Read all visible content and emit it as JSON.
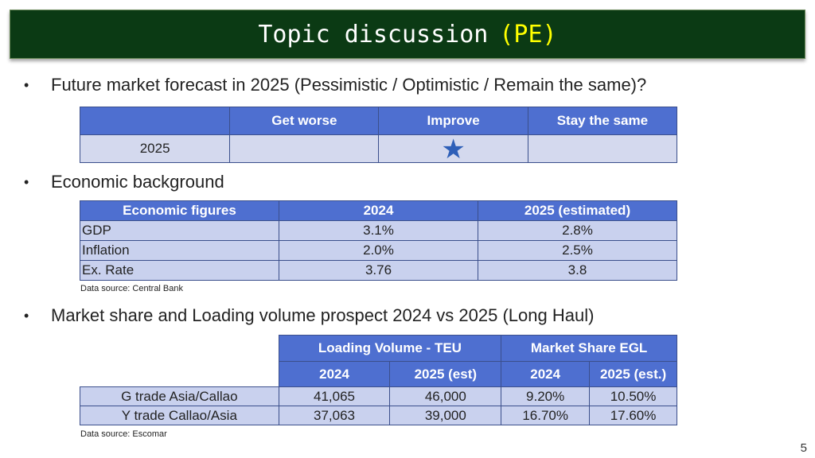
{
  "title": {
    "main": "Topic discussion",
    "accent": "(PE)"
  },
  "bullets": {
    "forecast": "Future market forecast in 2025 (Pessimistic / Optimistic / Remain the same)?",
    "economic": "Economic background",
    "market": "Market share and Loading volume prospect 2024 vs 2025 (Long Haul)"
  },
  "forecast_table": {
    "headers": [
      "",
      "Get worse",
      "Improve",
      "Stay the same"
    ],
    "row": {
      "label": "2025",
      "selected": "Improve",
      "marker_icon": "star-icon"
    }
  },
  "economic_table": {
    "headers": [
      "Economic figures",
      "2024",
      "2025 (estimated)"
    ],
    "rows": [
      [
        "GDP",
        "3.1%",
        "2.8%"
      ],
      [
        "Inflation",
        "2.0%",
        "2.5%"
      ],
      [
        "Ex. Rate",
        "3.76",
        "3.8"
      ]
    ],
    "source": "Data source: Central Bank"
  },
  "market_table": {
    "group_headers": [
      "Loading Volume - TEU",
      "Market Share EGL"
    ],
    "sub_headers": [
      "2024",
      "2025 (est)",
      "2024",
      "2025 (est.)"
    ],
    "rows": [
      [
        "G trade Asia/Callao",
        "41,065",
        "46,000",
        "9.20%",
        "10.50%"
      ],
      [
        "Y trade Callao/Asia",
        "37,063",
        "39,000",
        "16.70%",
        "17.60%"
      ]
    ],
    "source": "Data source: Escomar"
  },
  "colors": {
    "title_bg": "#0b3a14",
    "accent": "#ffff00",
    "header_bg": "#4e6fd0",
    "cell_bg": "#c9d1ee",
    "star": "#2e5fb8"
  },
  "page_number": "5"
}
